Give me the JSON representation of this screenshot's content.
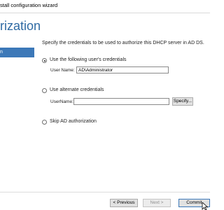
{
  "window": {
    "title": "stall configuration wizard"
  },
  "header": {
    "page_title": "rization"
  },
  "nav": {
    "items": [
      {
        "label": "n"
      }
    ]
  },
  "main": {
    "description": "Specify the credentials to be used to authorize this DHCP server in AD DS.",
    "options": [
      {
        "label": "Use the following user's credentials",
        "checked": true
      },
      {
        "label": "Use alternate credentials",
        "checked": false
      },
      {
        "label": "Skip AD authorization",
        "checked": false
      }
    ],
    "current_user": {
      "label": "User Name:",
      "value": "AD\\Administrator"
    },
    "alternate_user": {
      "label": "UserName:",
      "value": "",
      "specify_label": "Specify..."
    }
  },
  "footer": {
    "previous_label": "< Previous",
    "next_label": "Next >",
    "commit_label": "Commit"
  },
  "colors": {
    "accent": "#3c78b8",
    "title": "#2f6aa3"
  }
}
